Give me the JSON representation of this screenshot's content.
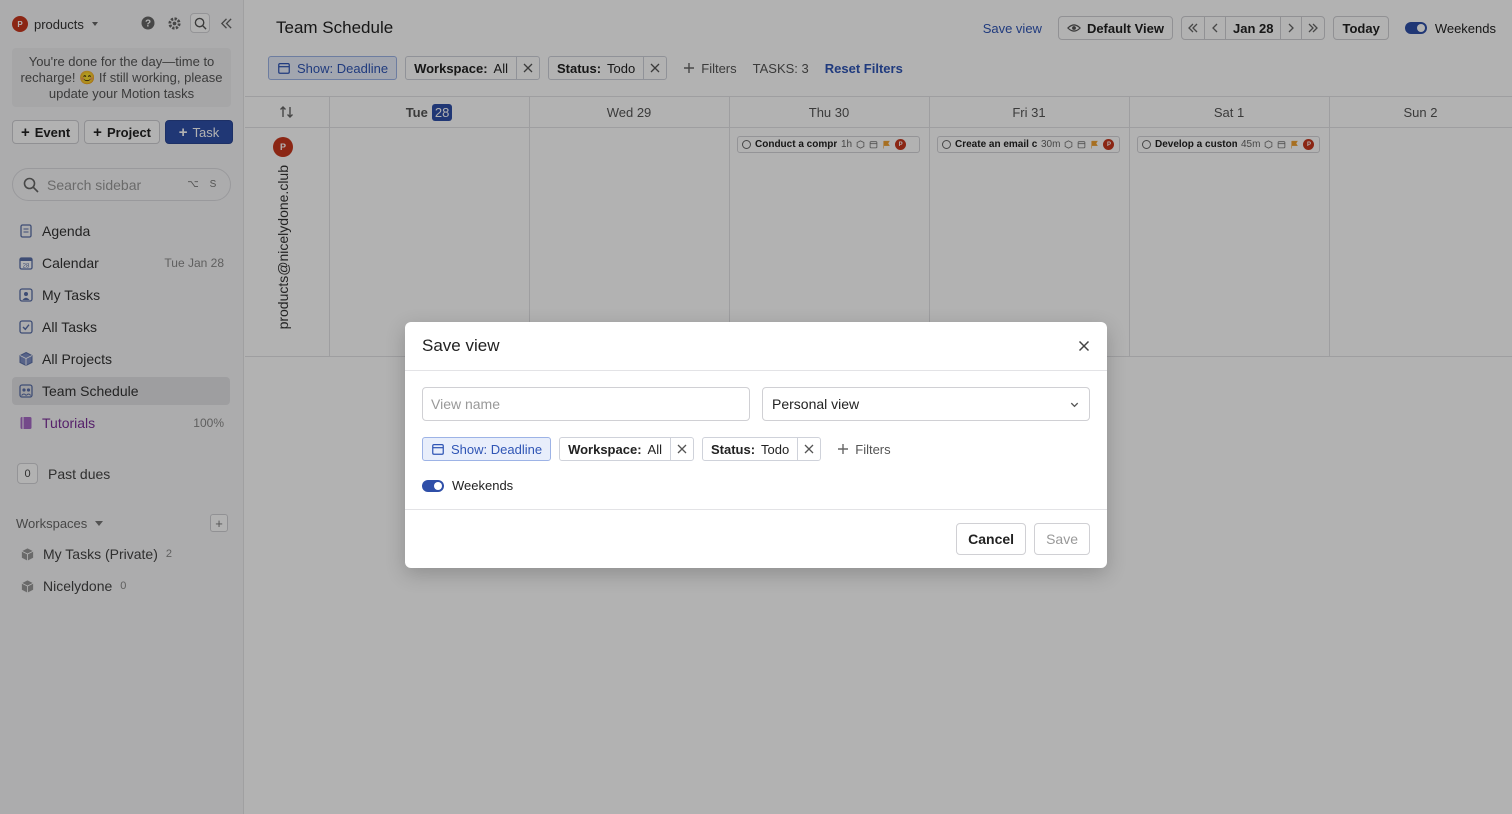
{
  "sidebar": {
    "workspace_avatar": "P",
    "workspace_name": "products",
    "notice": "You're done for the day—time to recharge! 😊 If still working, please update your Motion tasks",
    "create": {
      "event": "Event",
      "project": "Project",
      "task": "Task"
    },
    "search": {
      "placeholder": "Search sidebar",
      "shortcut_mod": "⌥",
      "shortcut_key": "S"
    },
    "nav": [
      {
        "label": "Agenda",
        "icon": "agenda-icon",
        "meta": ""
      },
      {
        "label": "Calendar",
        "icon": "calendar-icon",
        "meta": "Tue Jan 28"
      },
      {
        "label": "My Tasks",
        "icon": "person-icon",
        "meta": ""
      },
      {
        "label": "All Tasks",
        "icon": "checkbox-icon",
        "meta": ""
      },
      {
        "label": "All Projects",
        "icon": "cube-icon",
        "meta": ""
      },
      {
        "label": "Team Schedule",
        "icon": "team-icon",
        "meta": "",
        "active": true
      },
      {
        "label": "Tutorials",
        "icon": "book-icon",
        "meta": "100%"
      }
    ],
    "past_dues": {
      "count": "0",
      "label": "Past dues"
    },
    "workspaces_header": "Workspaces",
    "workspaces": [
      {
        "name": "My Tasks (Private)",
        "count": "2"
      },
      {
        "name": "Nicelydone",
        "count": "0"
      }
    ]
  },
  "header": {
    "title": "Team Schedule",
    "save_view": "Save view",
    "default_view": "Default View",
    "date": "Jan 28",
    "today": "Today",
    "weekends": "Weekends"
  },
  "filters": {
    "show_label": "Show: Deadline",
    "workspace_key": "Workspace:",
    "workspace_value": "All",
    "status_key": "Status:",
    "status_value": "Todo",
    "add_filters": "Filters",
    "task_count": "TASKS: 3",
    "reset": "Reset Filters"
  },
  "calendar": {
    "days": [
      {
        "dow": "Tue",
        "day": "28",
        "today": true
      },
      {
        "dow": "Wed",
        "day": "29"
      },
      {
        "dow": "Thu",
        "day": "30"
      },
      {
        "dow": "Fri",
        "day": "31"
      },
      {
        "dow": "Sat",
        "day": "1"
      },
      {
        "dow": "Sun",
        "day": "2"
      }
    ],
    "user_avatar": "P",
    "user_email": "products@nicelydone.club",
    "tasks": [
      {
        "name": "Conduct a comprehensive",
        "duration": "1h",
        "avatar": "P"
      },
      {
        "name": "Create an email campaign",
        "duration": "30m",
        "avatar": "P"
      },
      {
        "name": "Develop a customer survey",
        "duration": "45m",
        "avatar": "P"
      }
    ]
  },
  "modal": {
    "title": "Save view",
    "name_placeholder": "View name",
    "name_value": "",
    "visibility": "Personal view",
    "show_label": "Show: Deadline",
    "workspace_key": "Workspace:",
    "workspace_value": "All",
    "status_key": "Status:",
    "status_value": "Todo",
    "add_filters": "Filters",
    "weekends": "Weekends",
    "cancel": "Cancel",
    "save": "Save"
  },
  "colors": {
    "accent": "#2f4fa8",
    "link": "#2f55b5",
    "avatar": "#c8371e",
    "flag": "#f0a030"
  }
}
